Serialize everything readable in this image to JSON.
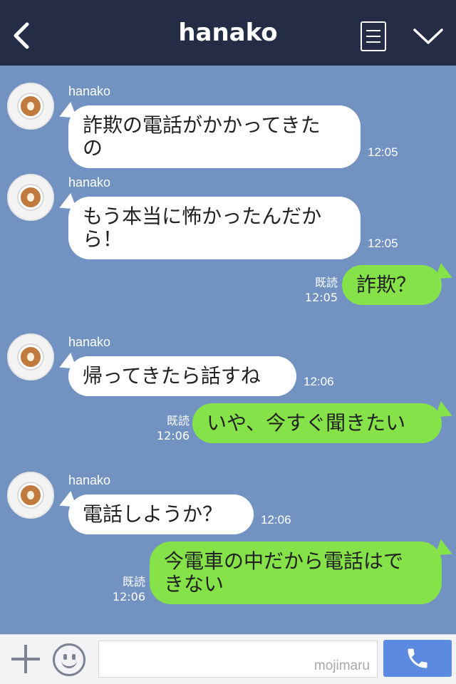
{
  "header": {
    "title": "hanako",
    "back_icon": "chevron-left-icon",
    "menu_icon": "list-icon",
    "collapse_icon": "chevron-down-icon",
    "background_color": "#242d45"
  },
  "chat": {
    "background_color": "#7292c1",
    "messages": [
      {
        "from": "hanako",
        "sender": "hanako",
        "text_lines": [
          "詐欺の電話がかかってきた",
          "の"
        ],
        "time": "12:05"
      },
      {
        "from": "hanako",
        "sender": "hanako",
        "text_lines": [
          "もう本当に怖かったんだか",
          "ら！"
        ],
        "time": "12:05"
      },
      {
        "from": "me",
        "text_lines": [
          "詐欺？"
        ],
        "read": "既読",
        "time": "12:05"
      },
      {
        "from": "hanako",
        "sender": "hanako",
        "text_lines": [
          "帰ってきたら話すね"
        ],
        "time": "12:06"
      },
      {
        "from": "me",
        "text_lines": [
          "いや、今すぐ聞きたい"
        ],
        "read": "既読",
        "time": "12:06"
      },
      {
        "from": "hanako",
        "sender": "hanako",
        "text_lines": [
          "電話しようか？"
        ],
        "time": "12:06"
      },
      {
        "from": "me",
        "text_lines": [
          "今電車の中だから電話はで",
          "きない"
        ],
        "read": "既読",
        "time": "12:06"
      }
    ],
    "incoming_bubble_color": "#ffffff",
    "outgoing_bubble_color": "#85e249"
  },
  "bottom_bar": {
    "plus_icon": "plus-icon",
    "emoji_icon": "smiley-icon",
    "input_value": "",
    "watermark": "mojimaru",
    "call_icon": "phone-icon",
    "call_button_color": "#5b8ae0"
  }
}
